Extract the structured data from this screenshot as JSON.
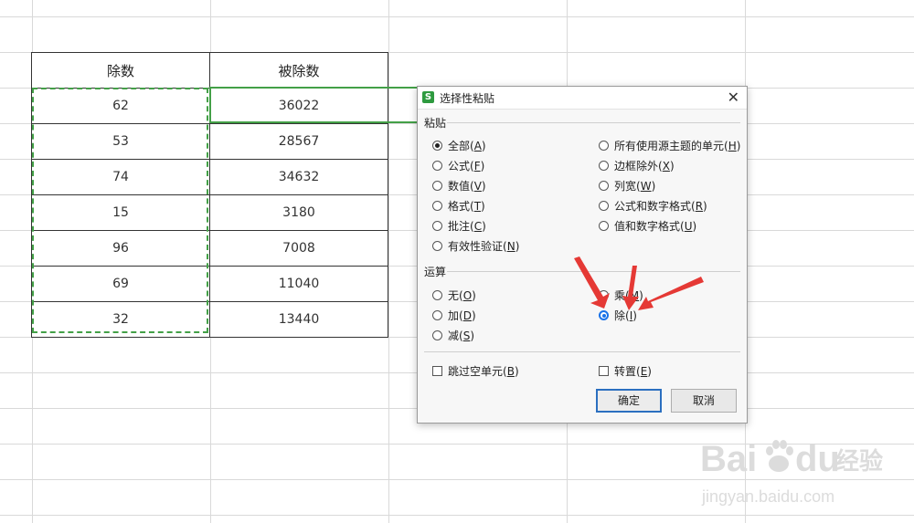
{
  "table": {
    "headers": [
      "除数",
      "被除数"
    ],
    "rows": [
      [
        "62",
        "36022"
      ],
      [
        "53",
        "28567"
      ],
      [
        "74",
        "34632"
      ],
      [
        "15",
        "3180"
      ],
      [
        "96",
        "7008"
      ],
      [
        "69",
        "11040"
      ],
      [
        "32",
        "13440"
      ]
    ]
  },
  "dialog": {
    "title": "选择性粘贴",
    "app_icon": "S",
    "close": "✕",
    "paste_section": "粘贴",
    "paste_left": [
      {
        "label": "全部",
        "key": "A",
        "checked": true
      },
      {
        "label": "公式",
        "key": "F",
        "checked": false
      },
      {
        "label": "数值",
        "key": "V",
        "checked": false
      },
      {
        "label": "格式",
        "key": "T",
        "checked": false
      },
      {
        "label": "批注",
        "key": "C",
        "checked": false
      },
      {
        "label": "有效性验证",
        "key": "N",
        "checked": false
      }
    ],
    "paste_right": [
      {
        "label": "所有使用源主题的单元",
        "key": "H"
      },
      {
        "label": "边框除外",
        "key": "X"
      },
      {
        "label": "列宽",
        "key": "W"
      },
      {
        "label": "公式和数字格式",
        "key": "R"
      },
      {
        "label": "值和数字格式",
        "key": "U"
      }
    ],
    "op_section": "运算",
    "op_left": [
      {
        "label": "无",
        "key": "O"
      },
      {
        "label": "加",
        "key": "D"
      },
      {
        "label": "减",
        "key": "S"
      }
    ],
    "op_right": [
      {
        "label": "乘",
        "key": "M",
        "checked": false
      },
      {
        "label": "除",
        "key": "I",
        "checked": true
      }
    ],
    "skip_blanks": {
      "label": "跳过空单元",
      "key": "B",
      "checked": false
    },
    "transpose": {
      "label": "转置",
      "key": "E",
      "checked": false
    },
    "ok": "确定",
    "cancel": "取消"
  },
  "colors": {
    "accent": "#1a73e8",
    "selection_green": "#43a047",
    "arrow_red": "#e53935",
    "app_icon": "#2e9a3f"
  },
  "watermark": {
    "brand": "Bai",
    "brand_suffix": "du",
    "cn": "经验",
    "url": "jingyan.baidu.com"
  }
}
